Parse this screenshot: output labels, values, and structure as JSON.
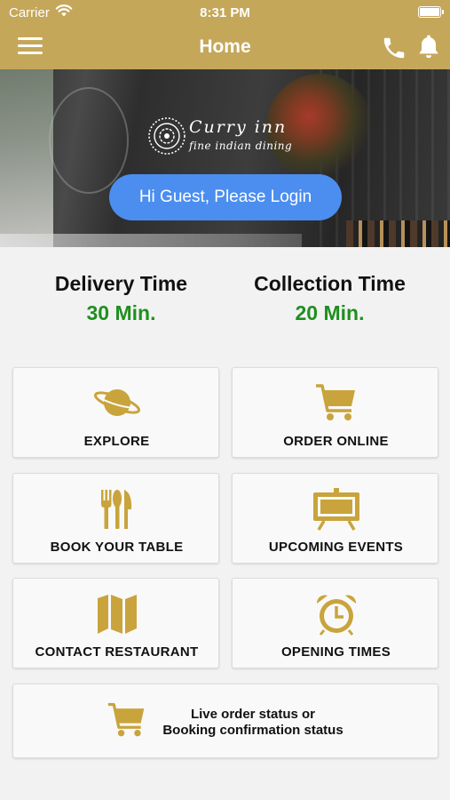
{
  "status_bar": {
    "carrier": "Carrier",
    "time": "8:31 PM",
    "wifi_icon": "wifi-icon",
    "battery_icon": "battery-icon"
  },
  "nav": {
    "title": "Home",
    "menu_icon": "hamburger-menu-icon",
    "phone_icon": "phone-icon",
    "bell_icon": "bell-icon"
  },
  "hero": {
    "logo_name": "Curry inn",
    "logo_tagline": "fine indian dining",
    "login_label": "Hi Guest, Please Login"
  },
  "times": {
    "delivery": {
      "label": "Delivery Time",
      "value": "30 Min."
    },
    "collection": {
      "label": "Collection Time",
      "value": "20 Min."
    }
  },
  "tiles": [
    {
      "label": "EXPLORE",
      "icon": "planet-icon"
    },
    {
      "label": "ORDER ONLINE",
      "icon": "shopping-cart-icon"
    },
    {
      "label": "BOOK YOUR TABLE",
      "icon": "cutlery-icon"
    },
    {
      "label": "UPCOMING EVENTS",
      "icon": "easel-board-icon"
    },
    {
      "label": "CONTACT RESTAURANT",
      "icon": "map-icon"
    },
    {
      "label": "OPENING TIMES",
      "icon": "alarm-clock-icon"
    }
  ],
  "status_tile": {
    "line1": "Live order status or",
    "line2": "Booking confirmation status",
    "icon": "shopping-cart-icon"
  },
  "colors": {
    "gold": "#c5a75a",
    "icon_gold": "#c9a43c",
    "login_blue": "#4b8ef0",
    "time_green": "#1f8f1f"
  }
}
